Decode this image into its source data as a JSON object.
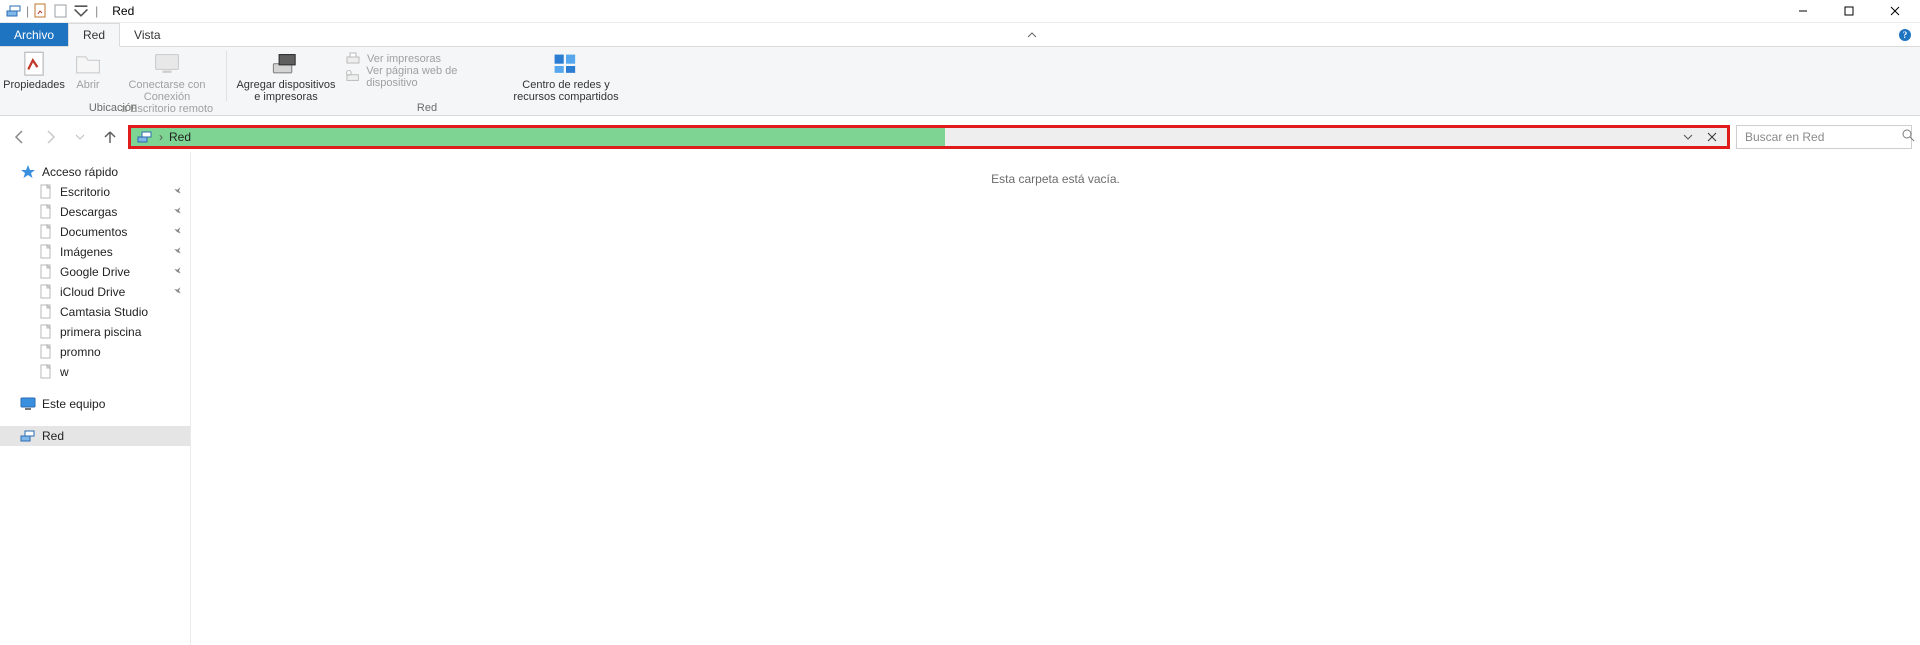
{
  "title": "Red",
  "ribbon": {
    "tabs": {
      "file": "Archivo",
      "network": "Red",
      "view": "Vista"
    },
    "groups": {
      "location": {
        "label": "Ubicación",
        "propiedades": "Propiedades",
        "abrir": "Abrir",
        "conectar_l1": "Conectarse con Conexión",
        "conectar_l2": "a Escritorio remoto"
      },
      "networkGroup": {
        "label": "Red",
        "agregar_l1": "Agregar dispositivos",
        "agregar_l2": "e impresoras",
        "ver_impresoras": "Ver impresoras",
        "ver_pagina": "Ver página web de dispositivo",
        "centro_l1": "Centro de redes y",
        "centro_l2": "recursos compartidos"
      }
    }
  },
  "address": {
    "progress_pct": 51,
    "location_label": "Red"
  },
  "search": {
    "placeholder": "Buscar en Red"
  },
  "sidebar": {
    "quick_access": "Acceso rápido",
    "items": [
      {
        "label": "Escritorio",
        "pinned": true
      },
      {
        "label": "Descargas",
        "pinned": true
      },
      {
        "label": "Documentos",
        "pinned": true
      },
      {
        "label": "Imágenes",
        "pinned": true
      },
      {
        "label": "Google Drive",
        "pinned": true
      },
      {
        "label": "iCloud Drive",
        "pinned": true
      },
      {
        "label": "Camtasia Studio",
        "pinned": false
      },
      {
        "label": "primera piscina",
        "pinned": false
      },
      {
        "label": "promno",
        "pinned": false
      },
      {
        "label": "w",
        "pinned": false
      }
    ],
    "this_pc": "Este equipo",
    "network": "Red"
  },
  "content": {
    "empty_message": "Esta carpeta está vacía."
  }
}
